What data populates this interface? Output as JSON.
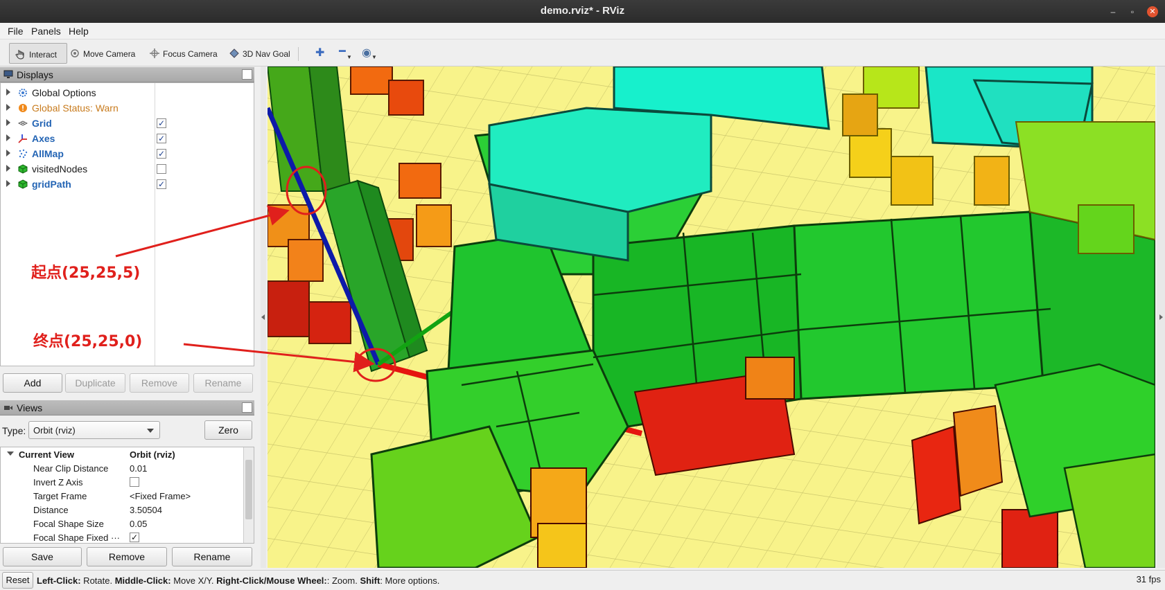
{
  "window": {
    "title": "demo.rviz* - RViz"
  },
  "menu": {
    "file": "File",
    "panels": "Panels",
    "help": "Help"
  },
  "toolbar": {
    "interact": "Interact",
    "move_camera": "Move Camera",
    "focus_camera": "Focus Camera",
    "nav_goal": "3D Nav Goal"
  },
  "displays": {
    "header": "Displays",
    "items": [
      {
        "label": "Global Options",
        "style": "normal",
        "checked": null
      },
      {
        "label": "Global Status: Warn",
        "style": "warn",
        "checked": null
      },
      {
        "label": "Grid",
        "style": "blue",
        "checked": true
      },
      {
        "label": "Axes",
        "style": "blue",
        "checked": true
      },
      {
        "label": "AllMap",
        "style": "blue",
        "checked": true
      },
      {
        "label": "visitedNodes",
        "style": "normal",
        "checked": false
      },
      {
        "label": "gridPath",
        "style": "blue",
        "checked": true
      }
    ],
    "buttons": {
      "add": "Add",
      "duplicate": "Duplicate",
      "remove": "Remove",
      "rename": "Rename"
    }
  },
  "views": {
    "header": "Views",
    "type_label": "Type:",
    "type_value": "Orbit (rviz)",
    "zero": "Zero",
    "current_view": {
      "key": "Current View",
      "value": "Orbit (rviz)"
    },
    "properties": [
      {
        "key": "Near Clip Distance",
        "value": "0.01"
      },
      {
        "key": "Invert Z Axis",
        "checkbox": false
      },
      {
        "key": "Target Frame",
        "value": "<Fixed Frame>"
      },
      {
        "key": "Distance",
        "value": "3.50504"
      },
      {
        "key": "Focal Shape Size",
        "value": "0.05"
      },
      {
        "key": "Focal Shape Fixed ···",
        "checkbox": true
      }
    ],
    "buttons": {
      "save": "Save",
      "remove": "Remove",
      "rename": "Rename"
    }
  },
  "annotations": {
    "start": "起点(25,25,5)",
    "end": "终点(25,25,0)"
  },
  "status": {
    "reset": "Reset",
    "left_click": "Left-Click:",
    "left_click_desc": " Rotate. ",
    "middle_click": "Middle-Click:",
    "middle_click_desc": " Move X/Y. ",
    "right_click": "Right-Click/Mouse Wheel:",
    "right_click_desc": ": Zoom. ",
    "shift": "Shift",
    "shift_desc": ": More options.",
    "fps": "31 fps"
  },
  "colors": {
    "annotation": "#e0201c",
    "floor": "#f8f38a",
    "blue_label": "#2364b4",
    "warn": "#c87b1d"
  }
}
